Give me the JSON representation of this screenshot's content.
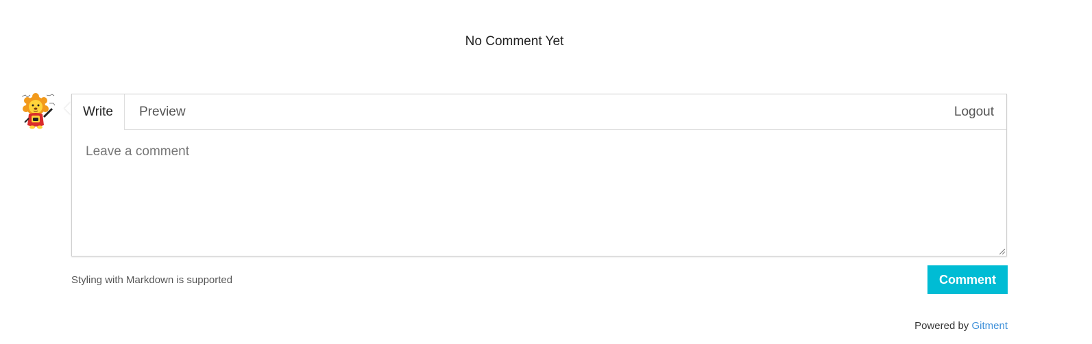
{
  "meta": {
    "no_comment_text": "No Comment Yet"
  },
  "user": {
    "avatar_icon": "lion-cartoon-avatar-icon"
  },
  "editor": {
    "tabs": [
      {
        "label": "Write",
        "active": true
      },
      {
        "label": "Preview",
        "active": false
      }
    ],
    "logout_label": "Logout",
    "textarea_placeholder": "Leave a comment",
    "textarea_value": ""
  },
  "footer": {
    "markdown_note": "Styling with Markdown is supported",
    "comment_button": "Comment",
    "powered_by_prefix": "Powered by",
    "powered_by_link": "Gitment"
  },
  "colors": {
    "accent": "#00bcd4",
    "link": "#3b8ed8"
  }
}
